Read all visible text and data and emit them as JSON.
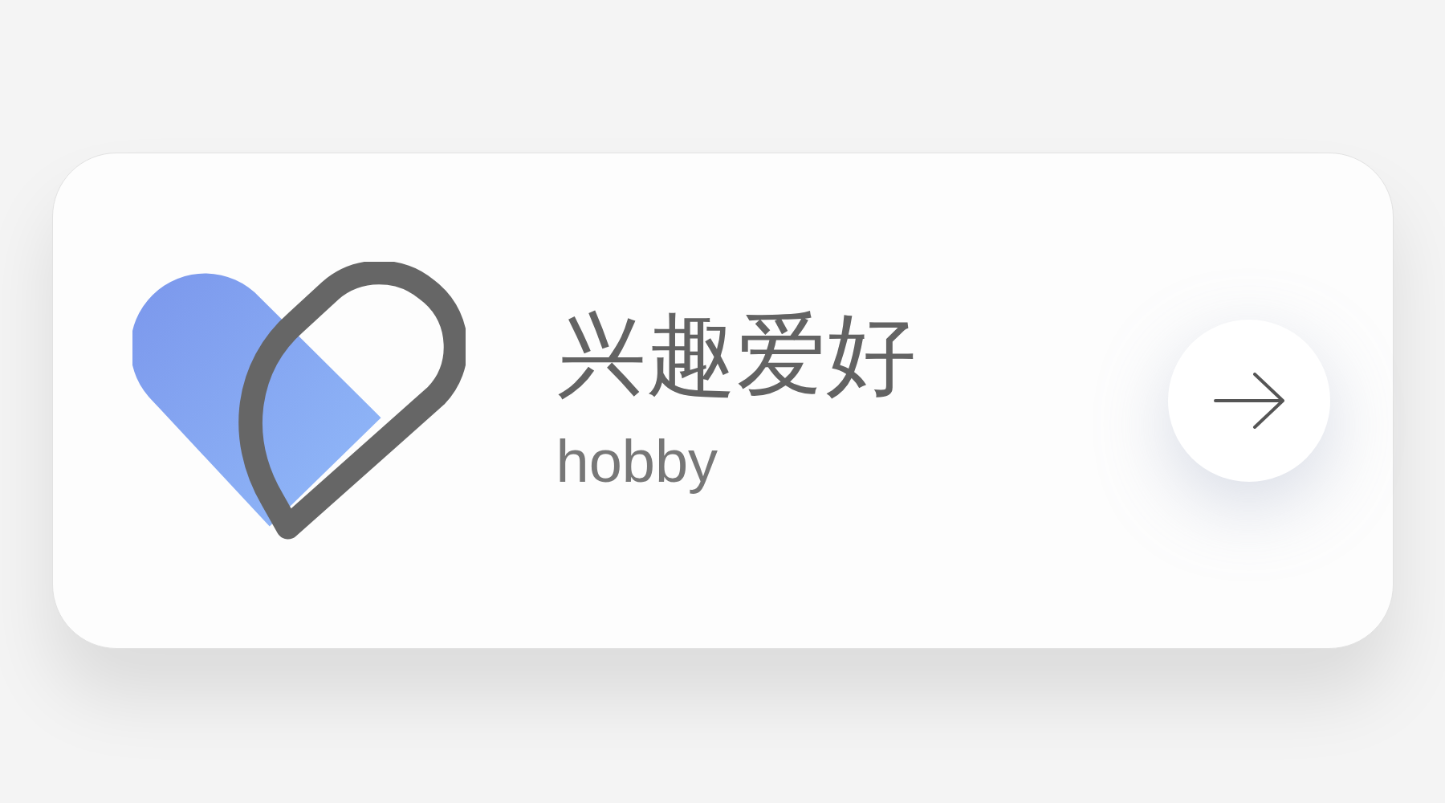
{
  "card": {
    "title": "兴趣爱好",
    "subtitle": "hobby"
  }
}
